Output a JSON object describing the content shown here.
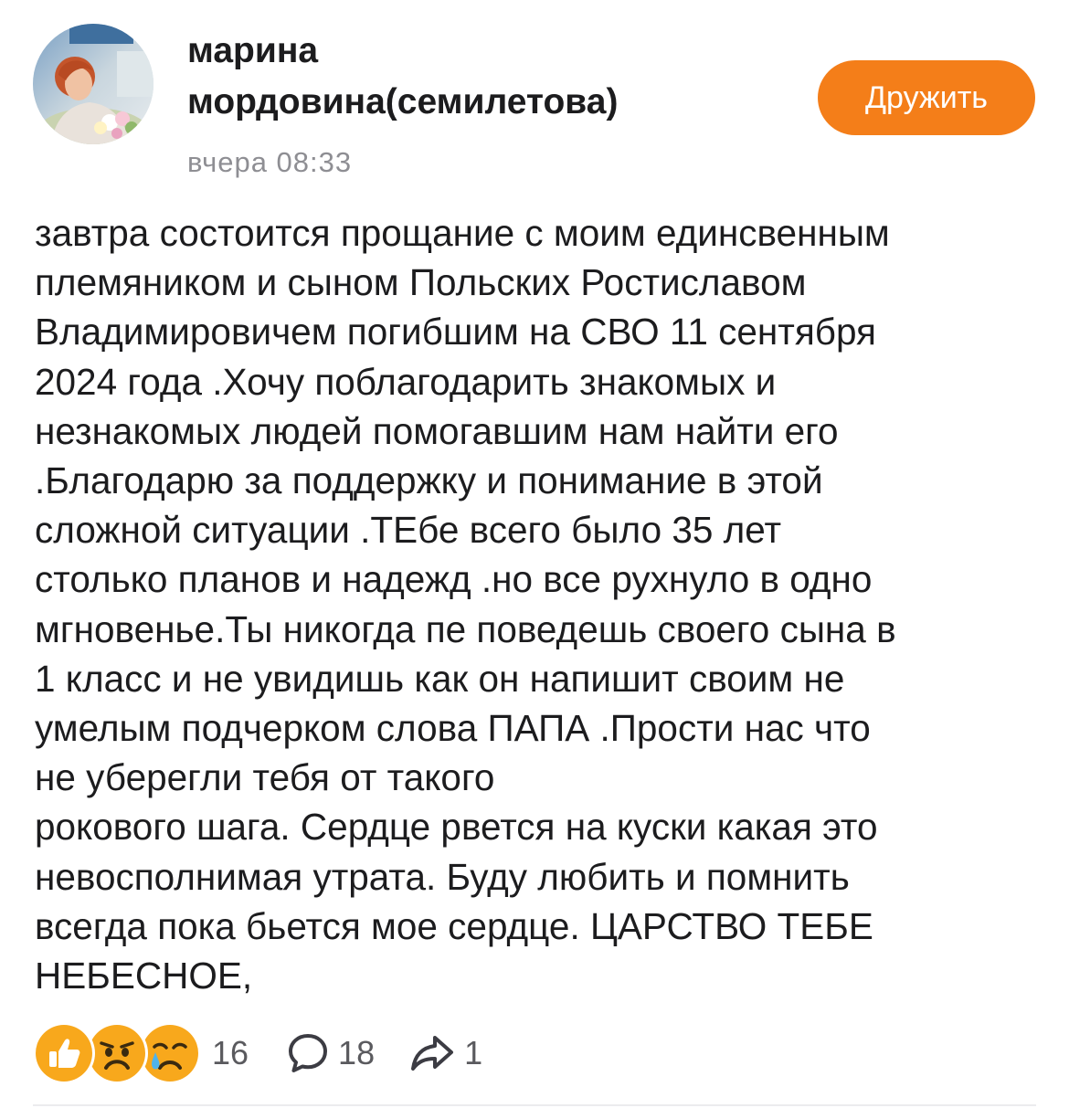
{
  "author": {
    "name_line1": "марина",
    "name_line2": "мордовина(семилетова)",
    "avatar_icon": "user-avatar-photo"
  },
  "post": {
    "time": "вчера 08:33",
    "lines": [
      "завтра состоится прощание с моим единсвенным",
      "племяником и сыном Польских Ростиславом",
      "Владимировичем погибшим на СВО 11 сентября",
      "2024 года .Хочу поблагодарить знакомых и",
      "незнакомых людей помогавшим нам найти его",
      ".Благодарю за поддержку и понимание в этой",
      "сложной ситуации .ТЕбе всего было 35 лет",
      "столько планов и надежд .но все рухнуло в одно",
      "мгновенье.Ты никогда пе поведешь своего сына в",
      "1 класс и не увидишь как он напишит своим не",
      "умелым подчерком слова ПАПА .Прости нас что",
      "не уберегли тебя от такого",
      "рокового шага. Сердце рвется на куски какая это",
      "невосполнимая утрата. Буду любить и помнить",
      "всегда пока бьется мое сердце. ЦАРСТВО ТЕБЕ",
      "НЕБЕСНОЕ,"
    ]
  },
  "actions": {
    "friend_button_label": "Дружить"
  },
  "stats": {
    "reactions_count": "16",
    "comments_count": "18",
    "shares_count": "1",
    "reaction_icons": [
      "thumbs-up-icon",
      "sad-face-icon",
      "crying-face-icon"
    ],
    "comment_icon": "comment-icon",
    "share_icon": "share-icon"
  },
  "colors": {
    "accent": "#f47e19",
    "reaction": "#f8a81c",
    "text": "#1c1c1e",
    "muted": "#8e8e93"
  }
}
